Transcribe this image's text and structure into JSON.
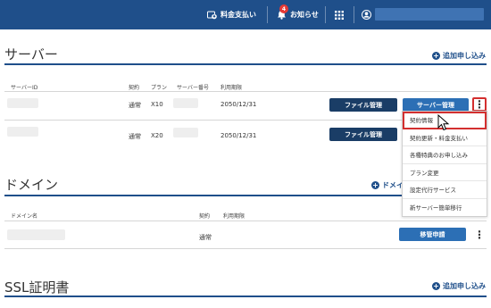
{
  "header": {
    "payment_label": "料金支払い",
    "notifications_label": "お知らせ",
    "notification_count": "4"
  },
  "server": {
    "title": "サーバー",
    "add_label": "追加申し込み",
    "columns": {
      "server_id": "サーバーID",
      "contract": "契約",
      "plan": "プラン",
      "server_number": "サーバー番号",
      "expiry": "利用期限"
    },
    "rows": [
      {
        "contract": "通常",
        "plan": "X10",
        "expiry": "2050/12/31",
        "file_btn": "ファイル管理",
        "server_btn": "サーバー管理"
      },
      {
        "contract": "通常",
        "plan": "X20",
        "expiry": "2050/12/31",
        "file_btn": "ファイル管理"
      }
    ],
    "menu": [
      "契約情報",
      "契約更新・料金支払い",
      "各種特典のお申し込み",
      "プラン変更",
      "設定代行サービス",
      "新サーバー簡単移行"
    ]
  },
  "domain": {
    "title": "ドメイン",
    "add_label": "ドメイ",
    "columns": {
      "name": "ドメイン名",
      "contract": "契約",
      "expiry": "利用期限"
    },
    "rows": [
      {
        "contract": "通常",
        "transfer_btn": "移管申請"
      }
    ]
  },
  "ssl": {
    "title": "SSL証明書",
    "add_label": "追加申し込み"
  }
}
